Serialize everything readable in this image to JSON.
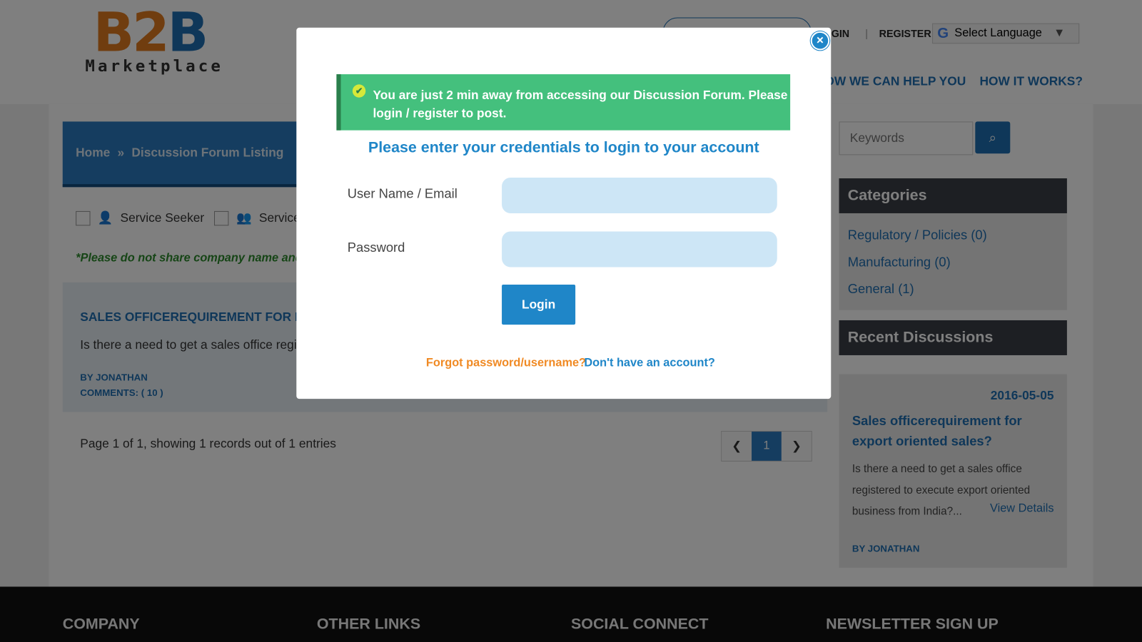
{
  "logo": {
    "b": "B",
    "two": "2",
    "b2": "B",
    "sub": "Marketplace"
  },
  "header": {
    "login": "LOGIN",
    "register": "REGISTER",
    "language": "Select Language",
    "nav": [
      "HOW WE CAN HELP YOU",
      "HOW IT WORKS?"
    ]
  },
  "breadcrumb": {
    "home": "Home",
    "current": "Discussion Forum Listing"
  },
  "filters": {
    "seeker": "Service Seeker",
    "provider": "Service Provider"
  },
  "note": "*Please do not share company name and contact details",
  "post": {
    "title": "SALES OFFICEREQUIREMENT FOR EXPORT ORIENTED SALES?",
    "excerpt": "Is there a need to get a sales office registered to execute export oriented business from India?",
    "by": "BY JONATHAN",
    "comments": "COMMENTS: ( 10 )"
  },
  "pagination": {
    "summary": "Page 1 of 1, showing 1 records out of 1 entries",
    "current": "1"
  },
  "search": {
    "placeholder": "Keywords"
  },
  "categories": {
    "title": "Categories",
    "items": [
      "Regulatory / Policies (0)",
      "Manufacturing (0)",
      "General (1)"
    ]
  },
  "recent": {
    "title": "Recent Discussions",
    "date": "2016-05-05",
    "headline": "Sales officerequirement for export oriented sales?",
    "excerpt": "Is there a need to get a sales office registered to execute export oriented business from India?...",
    "view": "View Details",
    "by": "BY JONATHAN"
  },
  "footer": [
    "COMPANY",
    "OTHER LINKS",
    "SOCIAL CONNECT",
    "NEWSLETTER SIGN UP"
  ],
  "modal": {
    "alert": "You are just 2 min away from accessing our Discussion Forum. Please login / register to post.",
    "title": "Please enter your credentials to login to your account",
    "user_label": "User Name / Email",
    "password_label": "Password",
    "login": "Login",
    "forgot": "Forgot password/username?",
    "signup": "Don't have an account?"
  }
}
